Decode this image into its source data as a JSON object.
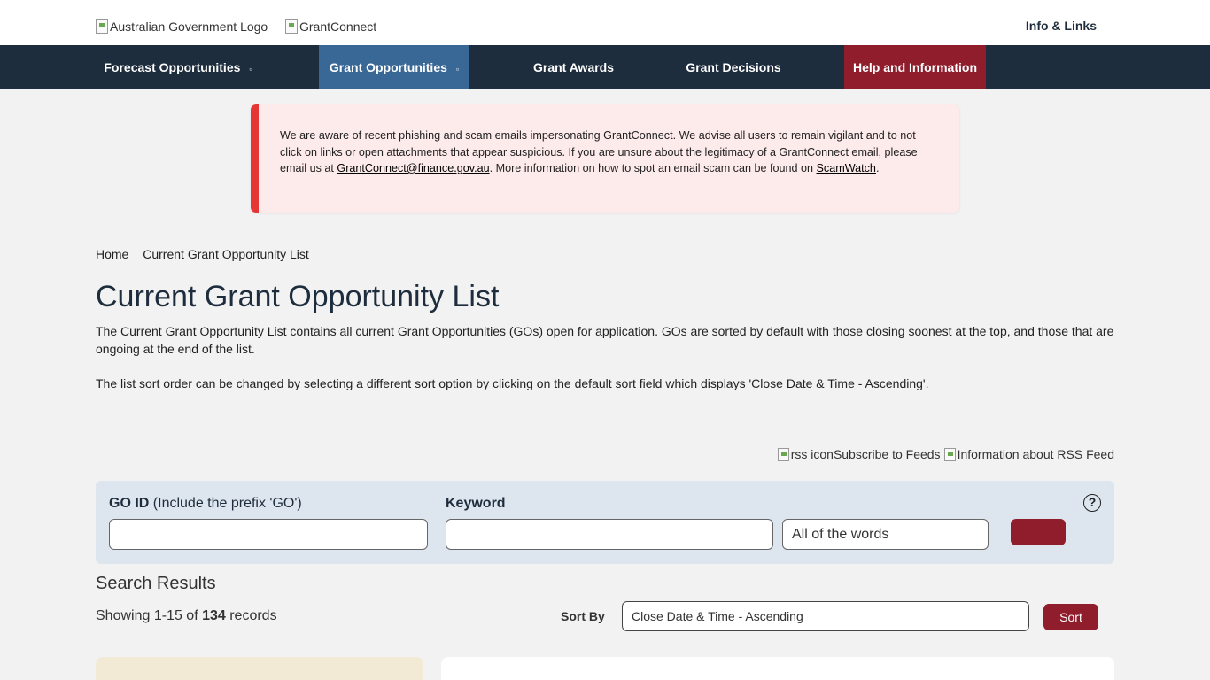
{
  "header": {
    "logo_gov_alt": "Australian Government Logo",
    "logo_gc_alt": "GrantConnect",
    "info_links": "Info & Links"
  },
  "nav": {
    "forecast": "Forecast Opportunities",
    "grant_opportunities": "Grant Opportunities",
    "grant_awards": "Grant Awards",
    "grant_decisions": "Grant Decisions",
    "help": "Help and Information",
    "caret": "▫"
  },
  "alert": {
    "text1": "We are aware of recent phishing and scam emails impersonating GrantConnect. We advise all users to remain vigilant and to not click on links or open attachments that appear suspicious. If you are unsure about the legitimacy of a GrantConnect email, please email us at ",
    "email": "GrantConnect@finance.gov.au",
    "text2": ". More information on how to spot an email scam can be found on ",
    "scamwatch": "ScamWatch",
    "text3": "."
  },
  "breadcrumb": {
    "home": "Home",
    "current": "Current Grant Opportunity List"
  },
  "page": {
    "title": "Current Grant Opportunity List",
    "desc1": "The Current Grant Opportunity List contains all current Grant Opportunities (GOs) open for application. GOs are sorted by default with those closing soonest at the top, and those that are ongoing at the end of the list.",
    "desc2": "The list sort order can be changed by selecting a different sort option by clicking on the default sort field which displays 'Close Date & Time - Ascending'."
  },
  "rss": {
    "icon_alt": "rss icon",
    "subscribe": "Subscribe to Feeds",
    "info_alt": "Information about RSS Feed"
  },
  "search": {
    "go_id_label": "GO ID",
    "go_id_hint": "(Include the prefix 'GO')",
    "keyword_label": "Keyword",
    "match_option": "All of the words",
    "help": "?"
  },
  "results": {
    "title": "Search Results",
    "showing_prefix": "Showing 1-15 of ",
    "total": "134",
    "showing_suffix": " records",
    "sort_label": "Sort By",
    "sort_value": "Close Date & Time - Ascending",
    "sort_button": "Sort"
  },
  "colors": {
    "nav_bg": "#1e2d3d",
    "nav_active": "#3a6896",
    "help_bg": "#8f1d2c",
    "alert_bg": "#fdeaea",
    "alert_border": "#e63535",
    "button": "#8f1d2c"
  }
}
